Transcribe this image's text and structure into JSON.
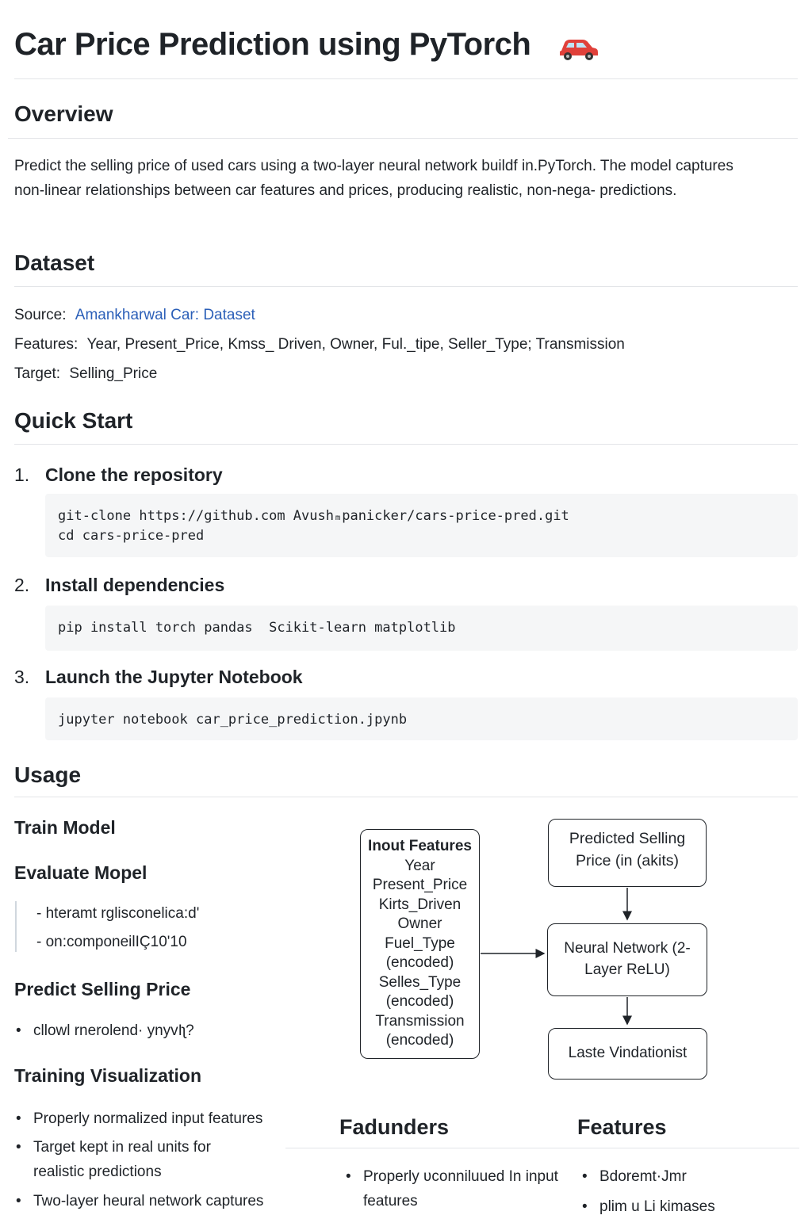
{
  "title": "Car Price Prediction using PyTorch",
  "title_icon": "car-icon",
  "overview": {
    "heading": "Overview",
    "text": "Predict the selling price of used cars using a two-layer neural network buildf in.PyTorch. The model captures non-linear relationships between car features and prices, producing realistic, non-nega- predictions."
  },
  "dataset": {
    "heading": "Dataset",
    "source_label": "Source:",
    "source_link": "Amankharwal Car: Dataset",
    "features_label": "Features:",
    "features_value": "Year, Present_Price, Kmss_ Driven, Owner, Ful._tipe, Seller_Type; Transmission",
    "target_label": "Target:",
    "target_value": "Selling_Price"
  },
  "quick_start": {
    "heading": "Quick Start",
    "steps": [
      {
        "num": "1.",
        "title": "Clone the repository",
        "code": "git-clone https://github.com Avushₘpanicker/cars-price-pred.git\ncd cars-price-pred"
      },
      {
        "num": "2.",
        "title": "Install dependencies",
        "code": "pip install torch pandas  Scikit-learn matplotlib"
      },
      {
        "num": "3.",
        "title": "Launch the Jupyter Notebook",
        "code": "jupyter notebook car_price_prediction.jpynb"
      }
    ]
  },
  "usage": {
    "heading": "Usage",
    "train": "Train Model",
    "evaluate": "Evaluate Mopel",
    "eval_items": [
      "hteramt rglisconelica:d'",
      "on:componeilIÇ10'10"
    ],
    "predict": "Predict Selling Price",
    "predict_items": [
      "cllowl rnerolend· ynyvIʅ?"
    ],
    "training_vis": "Training Visualization",
    "training_items": [
      "Properly normalized input features",
      "Target kept in real units for realistic predictions",
      "Two-layer heural network captures"
    ]
  },
  "diagram": {
    "input_title": "Inout Features",
    "input_items": [
      "Year",
      "Present_Price",
      "Kirts_Driven",
      "Owner",
      "Fuel_Type",
      "(encoded)",
      "Selles_Type",
      "(encoded)",
      "Transmission",
      "(encoded)"
    ],
    "output_box": "Predicted Selling Price (in (akits)",
    "nn_box": "Neural Network (2-Layer ReLU)",
    "loss_box": "Laste Vindationist"
  },
  "bottom": {
    "col1_heading": "Fadunders",
    "col1_items": [
      "Properly ʋconniluued In input features"
    ],
    "col2_heading": "Features",
    "col2_items": [
      "Bdoremt·Jmr",
      "plim u Li kimases"
    ]
  },
  "colors": {
    "link": "#2b5fb8",
    "code_bg": "#f5f6f7",
    "rule": "#e3e5e8"
  }
}
